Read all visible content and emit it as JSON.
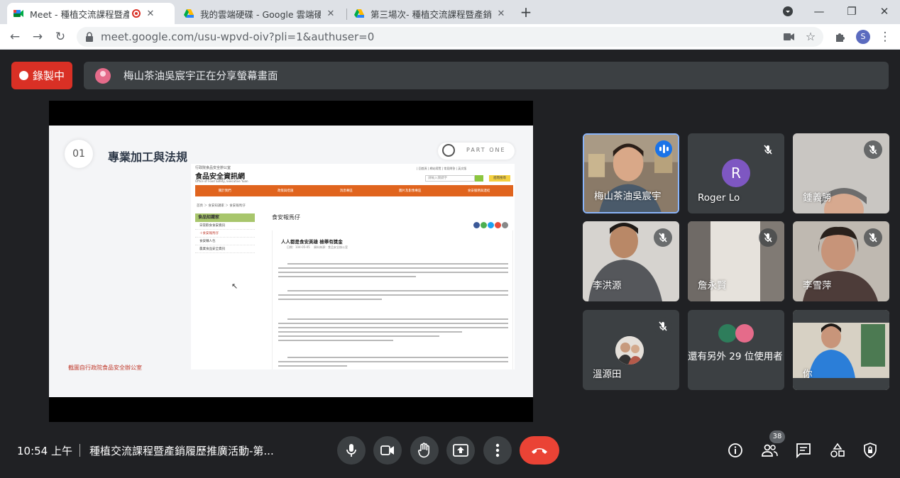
{
  "browser": {
    "tabs": [
      {
        "label": "Meet - 種植交流課程暨產銷履",
        "active": true
      },
      {
        "label": "我的雲端硬碟 - Google 雲端硬碟",
        "active": false
      },
      {
        "label": "第三場次- 種植交流課程暨產銷履",
        "active": false
      }
    ],
    "url": "meet.google.com/usu-wpvd-oiv?pli=1&authuser=0",
    "profile_initial": "S"
  },
  "meet": {
    "recording_label": "錄製中",
    "sharing_text": "梅山茶油吳宸宇正在分享螢幕畫面",
    "time": "10:54 上午",
    "meeting_title": "種植交流課程暨產銷履歷推廣活動-第...",
    "participant_count": "38",
    "colors": {
      "record": "#d93025",
      "end_call": "#ea4335",
      "speaking": "#8ab4f8"
    }
  },
  "slide": {
    "number": "01",
    "title": "專業加工與法規",
    "part_label": "PART ONE",
    "footer": "截圖自行政院食品安全辦公室",
    "web": {
      "org": "行政院食品安全辦公室",
      "site_title": "食品安全資訊網",
      "site_subtitle": "Office of Food Safety, Executive Yuan",
      "top_links": "| 回首頁 | 網站導覽 | 常見問答 | 英文版",
      "search_placeholder": "請輸入關鍵字",
      "advanced_label": "進階搜尋",
      "nav": [
        "關於我們",
        "政策與措施",
        "消息專區",
        "圖片及影像專區",
        "食安服務與連結"
      ],
      "breadcrumb": "首頁 ＞ 食安知識家 ＞ 食安報馬仔",
      "sidebar_head": "食品知識家",
      "sidebar_items": [
        "日常飲食食安資訊",
        "＋食安報馬仔",
        "食安懶人包",
        "農業食品安全資訊"
      ],
      "page_title": "食安報馬仔",
      "article_title": "人人都是食安英雄 檢舉有獎金",
      "article_meta": "日期：104-05-05 　資料來源：食品安全辦公室"
    }
  },
  "participants": [
    {
      "name": "梅山茶油吳宸宇",
      "speaking": true,
      "muted": false
    },
    {
      "name": "Roger Lo",
      "muted": true,
      "avatar_initial": "R"
    },
    {
      "name": "鍾義勝",
      "muted": true
    },
    {
      "name": "李洪源",
      "muted": true
    },
    {
      "name": "詹永賢",
      "muted": true
    },
    {
      "name": "李雪萍",
      "muted": true
    },
    {
      "name": "溫源田",
      "muted": true
    },
    {
      "name": "還有另外 29 位使用者"
    },
    {
      "name": "你"
    }
  ]
}
